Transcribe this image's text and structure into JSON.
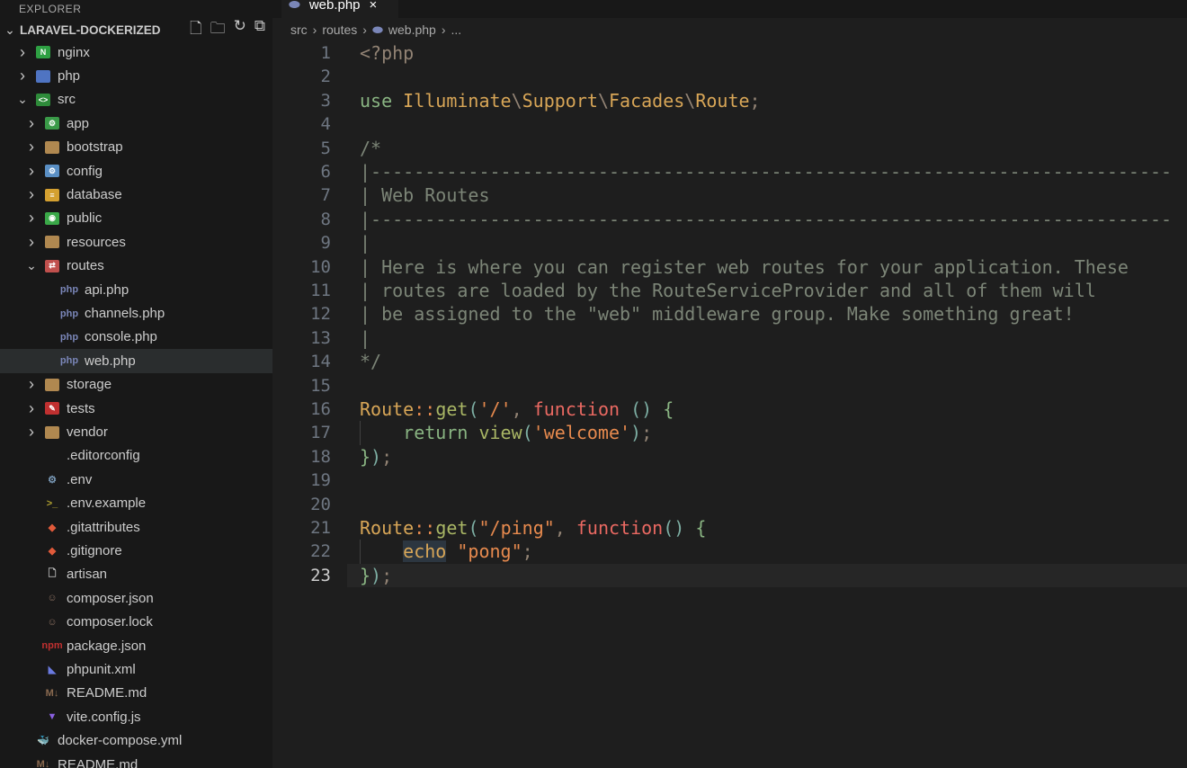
{
  "sidebar": {
    "title": "EXPLORER",
    "project": "LARAVEL-DOCKERIZED",
    "actions": [
      {
        "name": "new-file-icon",
        "glyph": "🗋"
      },
      {
        "name": "new-folder-icon",
        "glyph": "🗀"
      },
      {
        "name": "refresh-icon",
        "glyph": "↻"
      },
      {
        "name": "collapse-all-icon",
        "glyph": "⧉"
      }
    ],
    "items": [
      {
        "label": "nginx",
        "level": 0,
        "type": "folder",
        "open": false,
        "icon": "nginx-folder-icon",
        "color": "#2ea043",
        "mark": "N"
      },
      {
        "label": "php",
        "level": 0,
        "type": "folder",
        "open": false,
        "icon": "php-folder-icon",
        "color": "#4f74c2",
        "mark": ""
      },
      {
        "label": "src",
        "level": 0,
        "type": "folder",
        "open": true,
        "icon": "src-folder-icon",
        "color": "#2e8b3a",
        "mark": "<>"
      },
      {
        "label": "app",
        "level": 1,
        "type": "folder",
        "open": false,
        "icon": "app-folder-icon",
        "color": "#3a9a48",
        "mark": "⚙"
      },
      {
        "label": "bootstrap",
        "level": 1,
        "type": "folder",
        "open": false,
        "icon": "folder-icon",
        "color": "#b08850",
        "mark": ""
      },
      {
        "label": "config",
        "level": 1,
        "type": "folder",
        "open": false,
        "icon": "config-folder-icon",
        "color": "#5a8fc4",
        "mark": "⚙"
      },
      {
        "label": "database",
        "level": 1,
        "type": "folder",
        "open": false,
        "icon": "database-folder-icon",
        "color": "#d4a030",
        "mark": "≡"
      },
      {
        "label": "public",
        "level": 1,
        "type": "folder",
        "open": false,
        "icon": "public-folder-icon",
        "color": "#3aa848",
        "mark": "◉"
      },
      {
        "label": "resources",
        "level": 1,
        "type": "folder",
        "open": false,
        "icon": "folder-icon",
        "color": "#b08850",
        "mark": ""
      },
      {
        "label": "routes",
        "level": 1,
        "type": "folder",
        "open": true,
        "icon": "routes-folder-icon",
        "color": "#c0504d",
        "mark": "⇄"
      },
      {
        "label": "api.php",
        "level": 2,
        "type": "file",
        "icon": "php-file-icon",
        "color": "#7a86b8",
        "mark": "php"
      },
      {
        "label": "channels.php",
        "level": 2,
        "type": "file",
        "icon": "php-file-icon",
        "color": "#7a86b8",
        "mark": "php"
      },
      {
        "label": "console.php",
        "level": 2,
        "type": "file",
        "icon": "php-file-icon",
        "color": "#7a86b8",
        "mark": "php"
      },
      {
        "label": "web.php",
        "level": 2,
        "type": "file",
        "icon": "php-file-icon",
        "color": "#7a86b8",
        "mark": "php",
        "selected": true
      },
      {
        "label": "storage",
        "level": 1,
        "type": "folder",
        "open": false,
        "icon": "folder-icon",
        "color": "#b08850",
        "mark": ""
      },
      {
        "label": "tests",
        "level": 1,
        "type": "folder",
        "open": false,
        "icon": "tests-folder-icon",
        "color": "#c03030",
        "mark": "✎"
      },
      {
        "label": "vendor",
        "level": 1,
        "type": "folder",
        "open": false,
        "icon": "folder-icon",
        "color": "#b08850",
        "mark": ""
      },
      {
        "label": ".editorconfig",
        "level": 1,
        "type": "file",
        "icon": "editorconfig-icon",
        "color": "#e0e0e0",
        "mark": ""
      },
      {
        "label": ".env",
        "level": 1,
        "type": "file",
        "icon": "gear-icon",
        "color": "#7a9ab8",
        "mark": "⚙"
      },
      {
        "label": ".env.example",
        "level": 1,
        "type": "file",
        "icon": "terminal-icon",
        "color": "#b0a030",
        "mark": ">_"
      },
      {
        "label": ".gitattributes",
        "level": 1,
        "type": "file",
        "icon": "git-icon",
        "color": "#e05a3a",
        "mark": "◆"
      },
      {
        "label": ".gitignore",
        "level": 1,
        "type": "file",
        "icon": "git-icon",
        "color": "#e05a3a",
        "mark": "◆"
      },
      {
        "label": "artisan",
        "level": 1,
        "type": "file",
        "icon": "file-icon",
        "color": "#cccccc",
        "mark": "🗋"
      },
      {
        "label": "composer.json",
        "level": 1,
        "type": "file",
        "icon": "composer-icon",
        "color": "#8a7060",
        "mark": "☺"
      },
      {
        "label": "composer.lock",
        "level": 1,
        "type": "file",
        "icon": "composer-icon",
        "color": "#8a7060",
        "mark": "☺"
      },
      {
        "label": "package.json",
        "level": 1,
        "type": "file",
        "icon": "npm-icon",
        "color": "#c03030",
        "mark": "npm"
      },
      {
        "label": "phpunit.xml",
        "level": 1,
        "type": "file",
        "icon": "phpunit-icon",
        "color": "#6a7ae0",
        "mark": "◣"
      },
      {
        "label": "README.md",
        "level": 1,
        "type": "file",
        "icon": "markdown-icon",
        "color": "#8a6a50",
        "mark": "M↓"
      },
      {
        "label": "vite.config.js",
        "level": 1,
        "type": "file",
        "icon": "vite-icon",
        "color": "#8a60e0",
        "mark": "▼"
      },
      {
        "label": "docker-compose.yml",
        "level": 0,
        "type": "file",
        "icon": "docker-icon",
        "color": "#2a8ad0",
        "mark": "🐳"
      },
      {
        "label": "README.md",
        "level": 0,
        "type": "file",
        "icon": "markdown-icon",
        "color": "#8a6a50",
        "mark": "M↓"
      }
    ]
  },
  "tab": {
    "label": "web.php",
    "close": "×"
  },
  "breadcrumb": [
    "src",
    "routes",
    "web.php",
    "..."
  ],
  "editor": {
    "current_line": 23,
    "lines": [
      [
        [
          "<?php",
          "pun"
        ]
      ],
      [],
      [
        [
          "use ",
          "kw"
        ],
        [
          "Illuminate",
          "cls"
        ],
        [
          "\\",
          "pun"
        ],
        [
          "Support",
          "cls"
        ],
        [
          "\\",
          "pun"
        ],
        [
          "Facades",
          "cls"
        ],
        [
          "\\",
          "pun"
        ],
        [
          "Route",
          "cls"
        ],
        [
          ";",
          "pun"
        ]
      ],
      [],
      [
        [
          "/*",
          "cm"
        ]
      ],
      [
        [
          "|--------------------------------------------------------------------------",
          "cm"
        ]
      ],
      [
        [
          "| Web Routes",
          "cm"
        ]
      ],
      [
        [
          "|--------------------------------------------------------------------------",
          "cm"
        ]
      ],
      [
        [
          "|",
          "cm"
        ]
      ],
      [
        [
          "| Here is where you can register web routes for your application. These",
          "cm"
        ]
      ],
      [
        [
          "| routes are loaded by the RouteServiceProvider and all of them will",
          "cm"
        ]
      ],
      [
        [
          "| be assigned to the \"web\" middleware group. Make something great!",
          "cm"
        ]
      ],
      [
        [
          "|",
          "cm"
        ]
      ],
      [
        [
          "*/",
          "cm"
        ]
      ],
      [],
      [
        [
          "Route",
          "cls"
        ],
        [
          "::",
          "op"
        ],
        [
          "get",
          "fn"
        ],
        [
          "(",
          "par"
        ],
        [
          "'/'",
          "str"
        ],
        [
          ", ",
          "pun"
        ],
        [
          "function ",
          "red"
        ],
        [
          "() ",
          "par"
        ],
        [
          "{",
          "brace"
        ]
      ],
      [
        [
          "    return ",
          "kw"
        ],
        [
          "view",
          "fn"
        ],
        [
          "(",
          "par"
        ],
        [
          "'welcome'",
          "str"
        ],
        [
          ")",
          "par"
        ],
        [
          ";",
          "pun"
        ]
      ],
      [
        [
          "}",
          "brace"
        ],
        [
          ")",
          "par"
        ],
        [
          ";",
          "pun"
        ]
      ],
      [],
      [],
      [
        [
          "Route",
          "cls"
        ],
        [
          "::",
          "op"
        ],
        [
          "get",
          "fn"
        ],
        [
          "(",
          "par"
        ],
        [
          "\"/ping\"",
          "str"
        ],
        [
          ", ",
          "pun"
        ],
        [
          "function",
          "red"
        ],
        [
          "() ",
          "par"
        ],
        [
          "{",
          "brace"
        ]
      ],
      [
        [
          "    ",
          "fg"
        ],
        [
          "echo",
          "hl"
        ],
        [
          " ",
          "fg"
        ],
        [
          "\"pong\"",
          "str"
        ],
        [
          ";",
          "pun"
        ]
      ],
      [
        [
          "}",
          "brace"
        ],
        [
          ")",
          "par"
        ],
        [
          ";",
          "pun"
        ]
      ]
    ]
  }
}
